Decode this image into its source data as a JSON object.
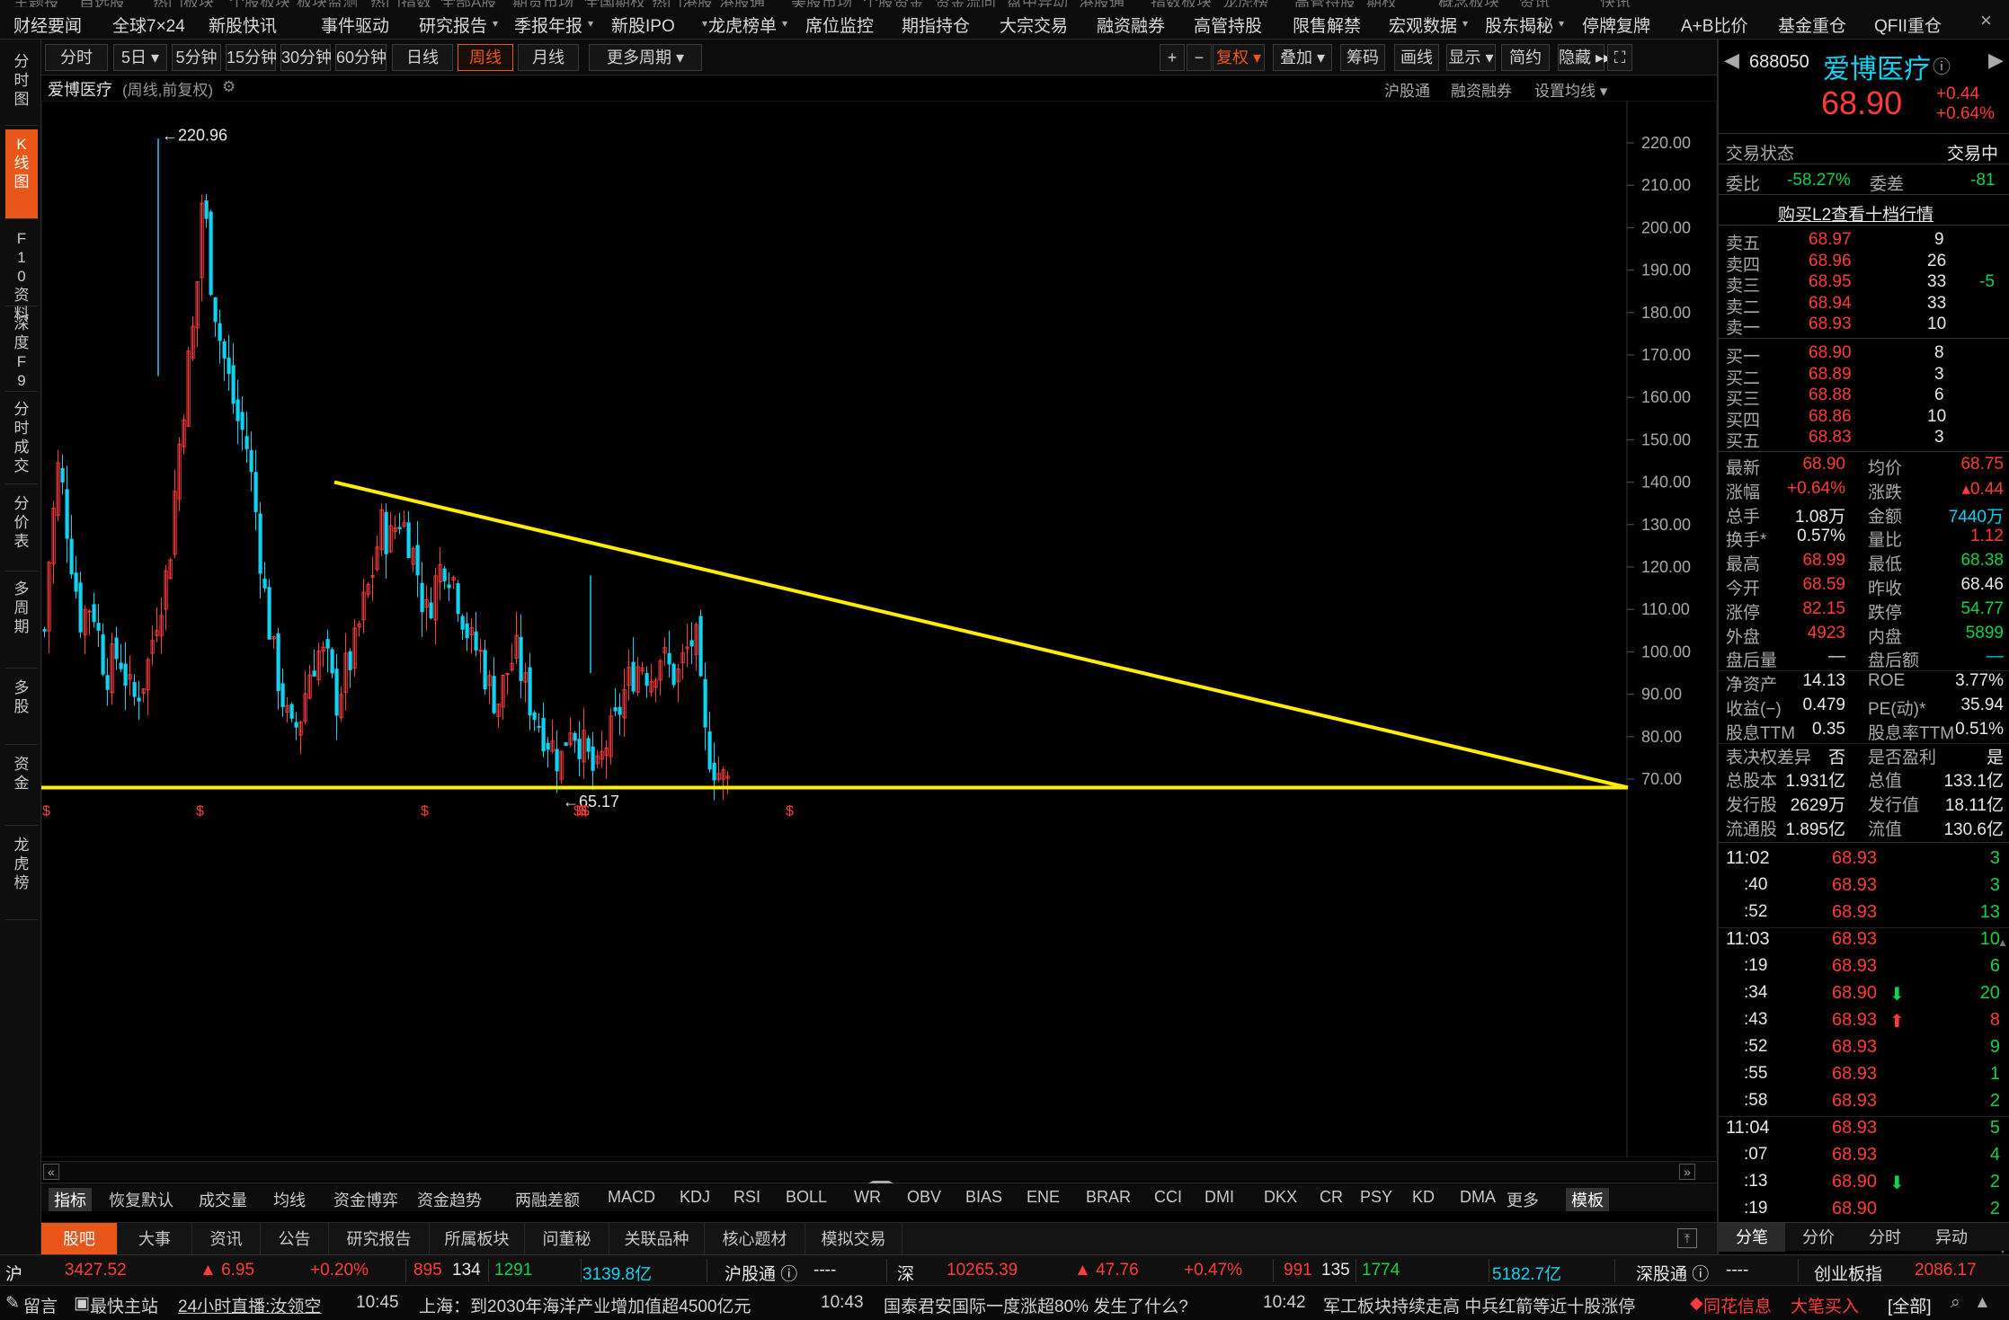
{
  "top_menu": {
    "row0": [
      "主题投",
      "自选股",
      "热门板块",
      "个股板块",
      "板块监测",
      "热门指数",
      "全部A股",
      "期货市场",
      "全国期权",
      "热门港股",
      "港股通",
      "美股市场",
      "个股资金",
      "资金流向",
      "盘中异动",
      "港股通",
      "指数板块",
      "龙虎榜",
      "高管持股",
      "期权",
      "概念板块",
      "资讯",
      "快讯"
    ],
    "items": [
      "财经要闻",
      "全球7×24",
      "新股快讯",
      "事件驱动",
      "研究报告",
      "季报年报",
      "新股IPO",
      "龙虎榜单",
      "席位监控",
      "期指持仓",
      "大宗交易",
      "融资融券",
      "高管持股",
      "限售解禁",
      "宏观数据",
      "股东揭秘",
      "停牌复牌",
      "A+B比价",
      "基金重仓",
      "QFII重仓"
    ],
    "close": "×"
  },
  "left_tabs": [
    {
      "label": "分时图",
      "active": false
    },
    {
      "label": "K线图",
      "active": true
    },
    {
      "label": "F10资料",
      "active": false
    },
    {
      "label": "深度F9",
      "active": false
    },
    {
      "label": "分时成交",
      "active": false
    },
    {
      "label": "分价表",
      "active": false
    },
    {
      "label": "多周期",
      "active": false
    },
    {
      "label": "多股",
      "active": false
    },
    {
      "label": "资金",
      "active": false
    },
    {
      "label": "龙虎榜",
      "active": false
    }
  ],
  "toolbar": {
    "periods": [
      "分时",
      "5日",
      "5分钟",
      "15分钟",
      "30分钟",
      "60分钟",
      "日线",
      "周线",
      "月线",
      "更多周期"
    ],
    "active_period": "周线",
    "right": [
      "+",
      "−",
      "复权",
      "叠加",
      "筹码",
      "画线",
      "显示",
      "简约",
      "隐藏 ▸▸",
      "⛶"
    ]
  },
  "chart_header": {
    "name": "爱博医疗",
    "sub": "(周线,前复权)",
    "links": [
      "沪股通",
      "融资融券",
      "设置均线"
    ]
  },
  "chart_data": {
    "type": "candlestick",
    "title": "爱博医疗 (周线,前复权)",
    "ylim": [
      62,
      226
    ],
    "yticks": [
      220,
      210,
      200,
      190,
      180,
      170,
      160,
      150,
      140,
      130,
      120,
      110,
      100,
      90,
      80,
      70
    ],
    "ytick_labels": [
      "220.00",
      "210.00",
      "200.00",
      "190.00",
      "180.00",
      "170.00",
      "160.00",
      "150.00",
      "140.00",
      "130.00",
      "120.00",
      "110.00",
      "100.00",
      "90.00",
      "80.00",
      "70.00"
    ],
    "max_label": "220.96",
    "min_label": "65.17",
    "trendline_top": {
      "from": 140,
      "to": 68
    },
    "support_line": 68,
    "colors": {
      "up": "#ff3b3b",
      "down": "#11d2f0",
      "trend": "#ffee00"
    }
  },
  "indicators": {
    "items": [
      "指标",
      "恢复默认",
      "成交量",
      "均线",
      "资金博弈",
      "资金趋势",
      "两融差额",
      "MACD",
      "KDJ",
      "RSI",
      "BOLL",
      "WR",
      "OBV",
      "BIAS",
      "ENE",
      "BRAR",
      "CCI",
      "DMI",
      "DKX",
      "CR",
      "PSY",
      "KD",
      "DMA",
      "更多",
      "模板"
    ]
  },
  "bottom_tabs": [
    "股吧",
    "大事",
    "资讯",
    "公告",
    "研究报告",
    "所属板块",
    "问董秘",
    "关联品种",
    "核心题材",
    "模拟交易"
  ],
  "index_bar": {
    "sh_label": "沪",
    "sh_value": "3427.52",
    "sh_change": "▲ 6.95",
    "sh_pct": "+0.20%",
    "sh_up": "895",
    "sh_flat": "134",
    "sh_down": "1291",
    "sh_amount": "3139.8亿",
    "hgt_label": "沪股通 ⓘ",
    "hgt_value": "----",
    "sz_label": "深",
    "sz_value": "10265.39",
    "sz_change": "▲ 47.76",
    "sz_pct": "+0.47%",
    "sz_up": "991",
    "sz_flat": "135",
    "sz_down": "1774",
    "sz_amount": "5182.7亿",
    "sgt_label": "深股通 ⓘ",
    "sgt_value": "----",
    "cyb_label": "创业板指",
    "cyb_value": "2086.17"
  },
  "news_bar": {
    "msg": "留言",
    "fast": "最快主站",
    "live": "24小时直播:汝领空",
    "n1_time": "10:45",
    "n1_text": "上海：到2030年海洋产业增加值超4500亿元",
    "n2_time": "10:43",
    "n2_text": "国泰君安国际一度涨超80% 发生了什么?",
    "n3_time": "10:42",
    "n3_text": "军工板块持续走高 中兵红箭等近十股涨停",
    "tong": "同花信息",
    "buy": "大笔买入",
    "all": "[全部]"
  },
  "quote": {
    "code": "688050",
    "name": "爱博医疗",
    "price": "68.90",
    "change": "+0.44",
    "pct": "+0.64%",
    "status_label": "交易状态",
    "status_value": "交易中",
    "wb_label": "委比",
    "wb_value": "-58.27%",
    "wc_label": "委差",
    "wc_value": "-81",
    "l2_link": "购买L2查看十档行情",
    "asks": [
      {
        "label": "卖五",
        "price": "68.97",
        "vol": "9",
        "chg": ""
      },
      {
        "label": "卖四",
        "price": "68.96",
        "vol": "26",
        "chg": ""
      },
      {
        "label": "卖三",
        "price": "68.95",
        "vol": "33",
        "chg": "-5"
      },
      {
        "label": "卖二",
        "price": "68.94",
        "vol": "33",
        "chg": ""
      },
      {
        "label": "卖一",
        "price": "68.93",
        "vol": "10",
        "chg": ""
      }
    ],
    "bids": [
      {
        "label": "买一",
        "price": "68.90",
        "vol": "8"
      },
      {
        "label": "买二",
        "price": "68.89",
        "vol": "3"
      },
      {
        "label": "买三",
        "price": "68.88",
        "vol": "6"
      },
      {
        "label": "买四",
        "price": "68.86",
        "vol": "10"
      },
      {
        "label": "买五",
        "price": "68.83",
        "vol": "3"
      }
    ],
    "stats": [
      {
        "l1": "最新",
        "v1": "68.90",
        "c1": "red",
        "l2": "均价",
        "v2": "68.75",
        "c2": "red"
      },
      {
        "l1": "涨幅",
        "v1": "+0.64%",
        "c1": "red",
        "l2": "涨跌",
        "v2": "▴0.44",
        "c2": "red"
      },
      {
        "l1": "总手",
        "v1": "1.08万",
        "c1": "white",
        "l2": "金额",
        "v2": "7440万",
        "c2": "cyan"
      },
      {
        "l1": "换手*",
        "v1": "0.57%",
        "c1": "white",
        "l2": "量比",
        "v2": "1.12",
        "c2": "red"
      },
      {
        "l1": "最高",
        "v1": "68.99",
        "c1": "red",
        "l2": "最低",
        "v2": "68.38",
        "c2": "green"
      },
      {
        "l1": "今开",
        "v1": "68.59",
        "c1": "red",
        "l2": "昨收",
        "v2": "68.46",
        "c2": "white"
      },
      {
        "l1": "涨停",
        "v1": "82.15",
        "c1": "red",
        "l2": "跌停",
        "v2": "54.77",
        "c2": "green"
      },
      {
        "l1": "外盘",
        "v1": "4923",
        "c1": "red",
        "l2": "内盘",
        "v2": "5899",
        "c2": "green"
      },
      {
        "l1": "盘后量",
        "v1": "—",
        "c1": "white",
        "l2": "盘后额",
        "v2": "—",
        "c2": "cyan"
      },
      {
        "l1": "净资产",
        "v1": "14.13",
        "c1": "white",
        "l2": "ROE",
        "v2": "3.77%",
        "c2": "white"
      },
      {
        "l1": "收益(−)",
        "v1": "0.479",
        "c1": "white",
        "l2": "PE(动)*",
        "v2": "35.94",
        "c2": "white"
      },
      {
        "l1": "股息TTM",
        "v1": "0.35",
        "c1": "white",
        "l2": "股息率TTM",
        "v2": "0.51%",
        "c2": "white"
      },
      {
        "l1": "表决权差异",
        "v1": "否",
        "c1": "white",
        "l2": "是否盈利",
        "v2": "是",
        "c2": "white"
      },
      {
        "l1": "总股本",
        "v1": "1.931亿",
        "c1": "white",
        "l2": "总值",
        "v2": "133.1亿",
        "c2": "white"
      },
      {
        "l1": "发行股",
        "v1": "2629万",
        "c1": "white",
        "l2": "发行值",
        "v2": "18.11亿",
        "c2": "white"
      },
      {
        "l1": "流通股",
        "v1": "1.895亿",
        "c1": "white",
        "l2": "流值",
        "v2": "130.6亿",
        "c2": "white"
      }
    ],
    "ticks": [
      {
        "t": "11:02",
        "p": "68.93",
        "v": "3",
        "arrow": ""
      },
      {
        "t": ":40",
        "p": "68.93",
        "v": "3",
        "arrow": ""
      },
      {
        "t": ":52",
        "p": "68.93",
        "v": "13",
        "arrow": ""
      },
      {
        "t": "11:03",
        "p": "68.93",
        "v": "10",
        "arrow": ""
      },
      {
        "t": ":19",
        "p": "68.93",
        "v": "6",
        "arrow": ""
      },
      {
        "t": ":34",
        "p": "68.90",
        "v": "20",
        "arrow": "⬇"
      },
      {
        "t": ":43",
        "p": "68.93",
        "v": "8",
        "arrow": "⬆"
      },
      {
        "t": ":52",
        "p": "68.93",
        "v": "9",
        "arrow": ""
      },
      {
        "t": ":55",
        "p": "68.93",
        "v": "1",
        "arrow": ""
      },
      {
        "t": ":58",
        "p": "68.93",
        "v": "2",
        "arrow": ""
      },
      {
        "t": "11:04",
        "p": "68.93",
        "v": "5",
        "arrow": ""
      },
      {
        "t": ":07",
        "p": "68.93",
        "v": "4",
        "arrow": ""
      },
      {
        "t": ":13",
        "p": "68.90",
        "v": "2",
        "arrow": "⬇"
      },
      {
        "t": ":19",
        "p": "68.90",
        "v": "2",
        "arrow": ""
      }
    ],
    "right_tabs": [
      "分笔",
      "分价",
      "分时",
      "异动"
    ]
  }
}
